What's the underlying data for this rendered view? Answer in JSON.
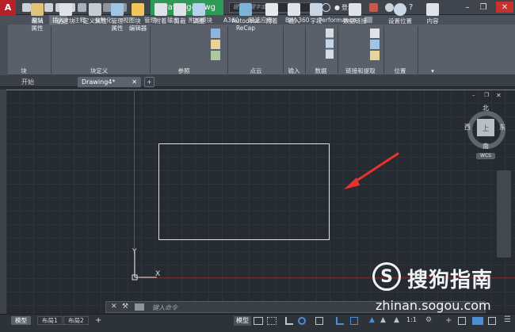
{
  "titlebar": {
    "doc_title": "Drawing4.dwg",
    "search_placeholder": "键入关键字或短语",
    "login": "登录",
    "app_button": "A"
  },
  "ribbon_tabs": [
    "默认",
    "插入",
    "注释",
    "参数化",
    "视图",
    "管理",
    "输出",
    "附加模块",
    "A360",
    "精选应用",
    "BIM 360",
    "Performance"
  ],
  "active_tab": "插入",
  "ribbon": {
    "block_panel_left": "块",
    "btn_edit_attr": "编辑\n属性",
    "btn_create_block": "创建块",
    "btn_define_attr": "定义属性",
    "btn_manage_attr": "管理\n属性",
    "btn_block_editor": "块\n编辑器",
    "panel_block_def": "块定义",
    "btn_attach": "附着",
    "btn_clip": "剪裁",
    "btn_adjust": "调整",
    "panel_reference": "参照",
    "btn_recap": "Autodesk\nReCap",
    "btn_attach2": "附着",
    "panel_pointcloud": "点云",
    "btn_import": "输入",
    "panel_import": "输入",
    "btn_field": "字段",
    "panel_data": "数据",
    "btn_datalink": "数据链接",
    "panel_link": "链接和提取",
    "btn_set_location": "设置位置",
    "panel_location": "位置",
    "btn_content": "内容"
  },
  "file_tabs": {
    "start": "开始",
    "drawing": "Drawing4*",
    "add": "+"
  },
  "viewcube": {
    "north": "北",
    "south": "南",
    "east": "东",
    "west": "西",
    "top": "上",
    "wcs": "WCS"
  },
  "ucs": {
    "y": "Y",
    "x": "X"
  },
  "command": {
    "placeholder": "键入命令"
  },
  "layout_tabs": [
    "模型",
    "布局1",
    "布局2"
  ],
  "status": {
    "model": "模型",
    "scale": "1:1"
  },
  "watermark": {
    "brand": "搜狗指南",
    "url": "zhinan.sogou.com"
  },
  "colors": {
    "accent_green": "#2f9a57",
    "close_red": "#c9312f",
    "arrow_red": "#e8322b"
  }
}
